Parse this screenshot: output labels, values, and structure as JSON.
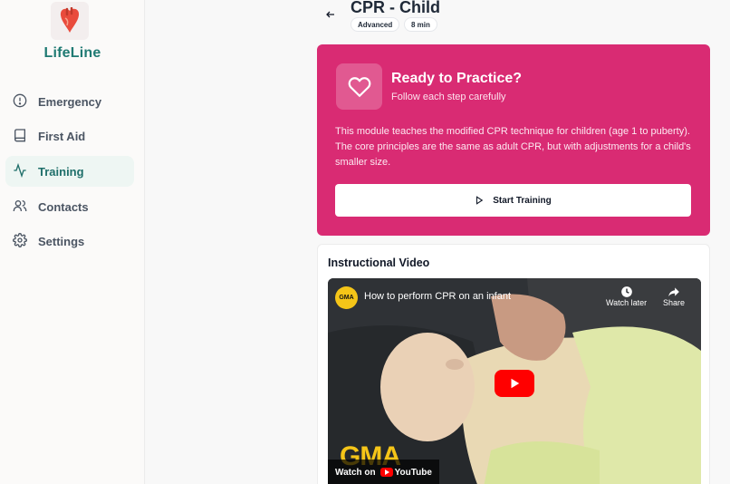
{
  "app": {
    "brand": "LifeLine"
  },
  "sidebar": {
    "items": [
      {
        "label": "Emergency",
        "icon": "alert-circle-icon"
      },
      {
        "label": "First Aid",
        "icon": "book-icon"
      },
      {
        "label": "Training",
        "icon": "activity-icon",
        "active": true
      },
      {
        "label": "Contacts",
        "icon": "users-icon"
      },
      {
        "label": "Settings",
        "icon": "gear-icon"
      }
    ]
  },
  "page": {
    "title": "CPR - Child",
    "badges": [
      "Advanced",
      "8 min"
    ]
  },
  "hero": {
    "heading": "Ready to Practice?",
    "subheading": "Follow each step carefully",
    "description": "This module teaches the modified CPR technique for children (age 1 to puberty). The core principles are the same as adult CPR, but with adjustments for a child's smaller size.",
    "button_label": "Start Training",
    "color": "#d92b73"
  },
  "video": {
    "section_title": "Instructional Video",
    "title": "How to perform CPR on an infant",
    "channel_badge": "GMA",
    "watch_later": "Watch later",
    "share": "Share",
    "watch_on": "Watch on",
    "youtube": "YouTube"
  }
}
